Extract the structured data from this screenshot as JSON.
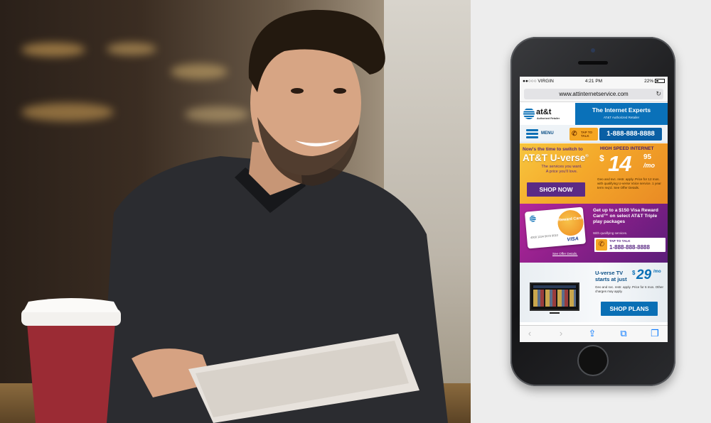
{
  "photo": {
    "description_icon": "man-with-tablet-and-coffee-photo"
  },
  "status_bar": {
    "carrier": "●●○○○ VIRGIN",
    "wifi_icon": "wifi-icon",
    "time": "4:21 PM",
    "battery": "22%"
  },
  "browser": {
    "url": "www.attinternetservice.com",
    "reload_icon": "reload-icon"
  },
  "header": {
    "logo_text": "at&t",
    "logo_sub": "Authorized Retailer",
    "title": "The  Internet Experts",
    "subtitle": "AT&T Authorized Retailer"
  },
  "menu_bar": {
    "menu_label": "MENU",
    "tap_badge": [
      "TAP TO",
      "TALK"
    ],
    "phone": "1-888-888-8888"
  },
  "promo1": {
    "line1": "Now's the time to switch to",
    "line2": "AT&T U-verse",
    "line3a": "The services you want.",
    "line3b": "A price you'll love.",
    "button": "SHOP NOW",
    "label": "HIGH SPEED INTERNET",
    "price_symbol": "$",
    "price_dollars": "14",
    "price_cents": "95",
    "price_period": "/mo",
    "fine_print": "Geo and svc. restr. apply. Price for 12 mos. with qualifying U-verse Voice service. 1 year term req'd. See Offer Details."
  },
  "promo2": {
    "card_label": "Reward Card",
    "card_number": "4000 1234 5678 9010",
    "card_brand": "VISA",
    "see_offer": "See Offer Details.",
    "headline": "Get up to a $150 Visa Reward Card™ on select AT&T Triple play packages",
    "sub": "With qualifying services.",
    "tap_label": "TAP TO TALK",
    "tap_phone": "1-888-888-8888"
  },
  "promo3": {
    "line1a": "U-verse TV",
    "line1b": "starts at just",
    "price_symbol": "$",
    "price": "29",
    "price_period": "/mo",
    "fine_print": "Geo and svc. restr. apply. Price for 6 mos. Other charges may apply.",
    "button": "SHOP PLANS"
  },
  "toolbar": {
    "back": "‹",
    "forward": "›",
    "share": "⇪",
    "bookmarks": "⧉",
    "tabs": "❐"
  },
  "colors": {
    "att_blue": "#0a71b9",
    "purple": "#5b2a85",
    "orange": "#f5a623"
  }
}
